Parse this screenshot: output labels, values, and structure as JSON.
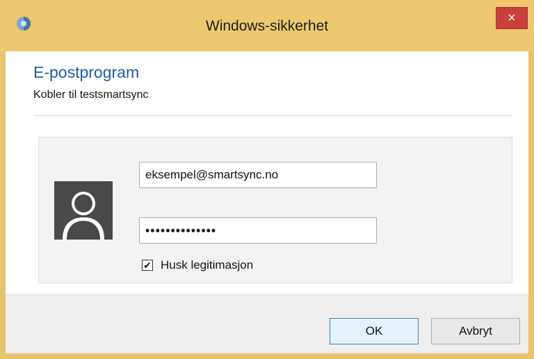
{
  "window": {
    "title": "Windows-sikkerhet",
    "close_label": "×"
  },
  "dialog": {
    "heading": "E-postprogram",
    "subheading": "Kobler til testsmartsync"
  },
  "credentials": {
    "username_value": "eksempel@smartsync.no",
    "password_masked": "••••••••••••••",
    "remember_checked": true,
    "check_mark": "✔",
    "remember_label": "Husk legitimasjon"
  },
  "buttons": {
    "ok": "OK",
    "cancel": "Avbryt"
  },
  "colors": {
    "frame": "#edc871",
    "heading": "#1b5ea6",
    "close": "#c7403b"
  }
}
